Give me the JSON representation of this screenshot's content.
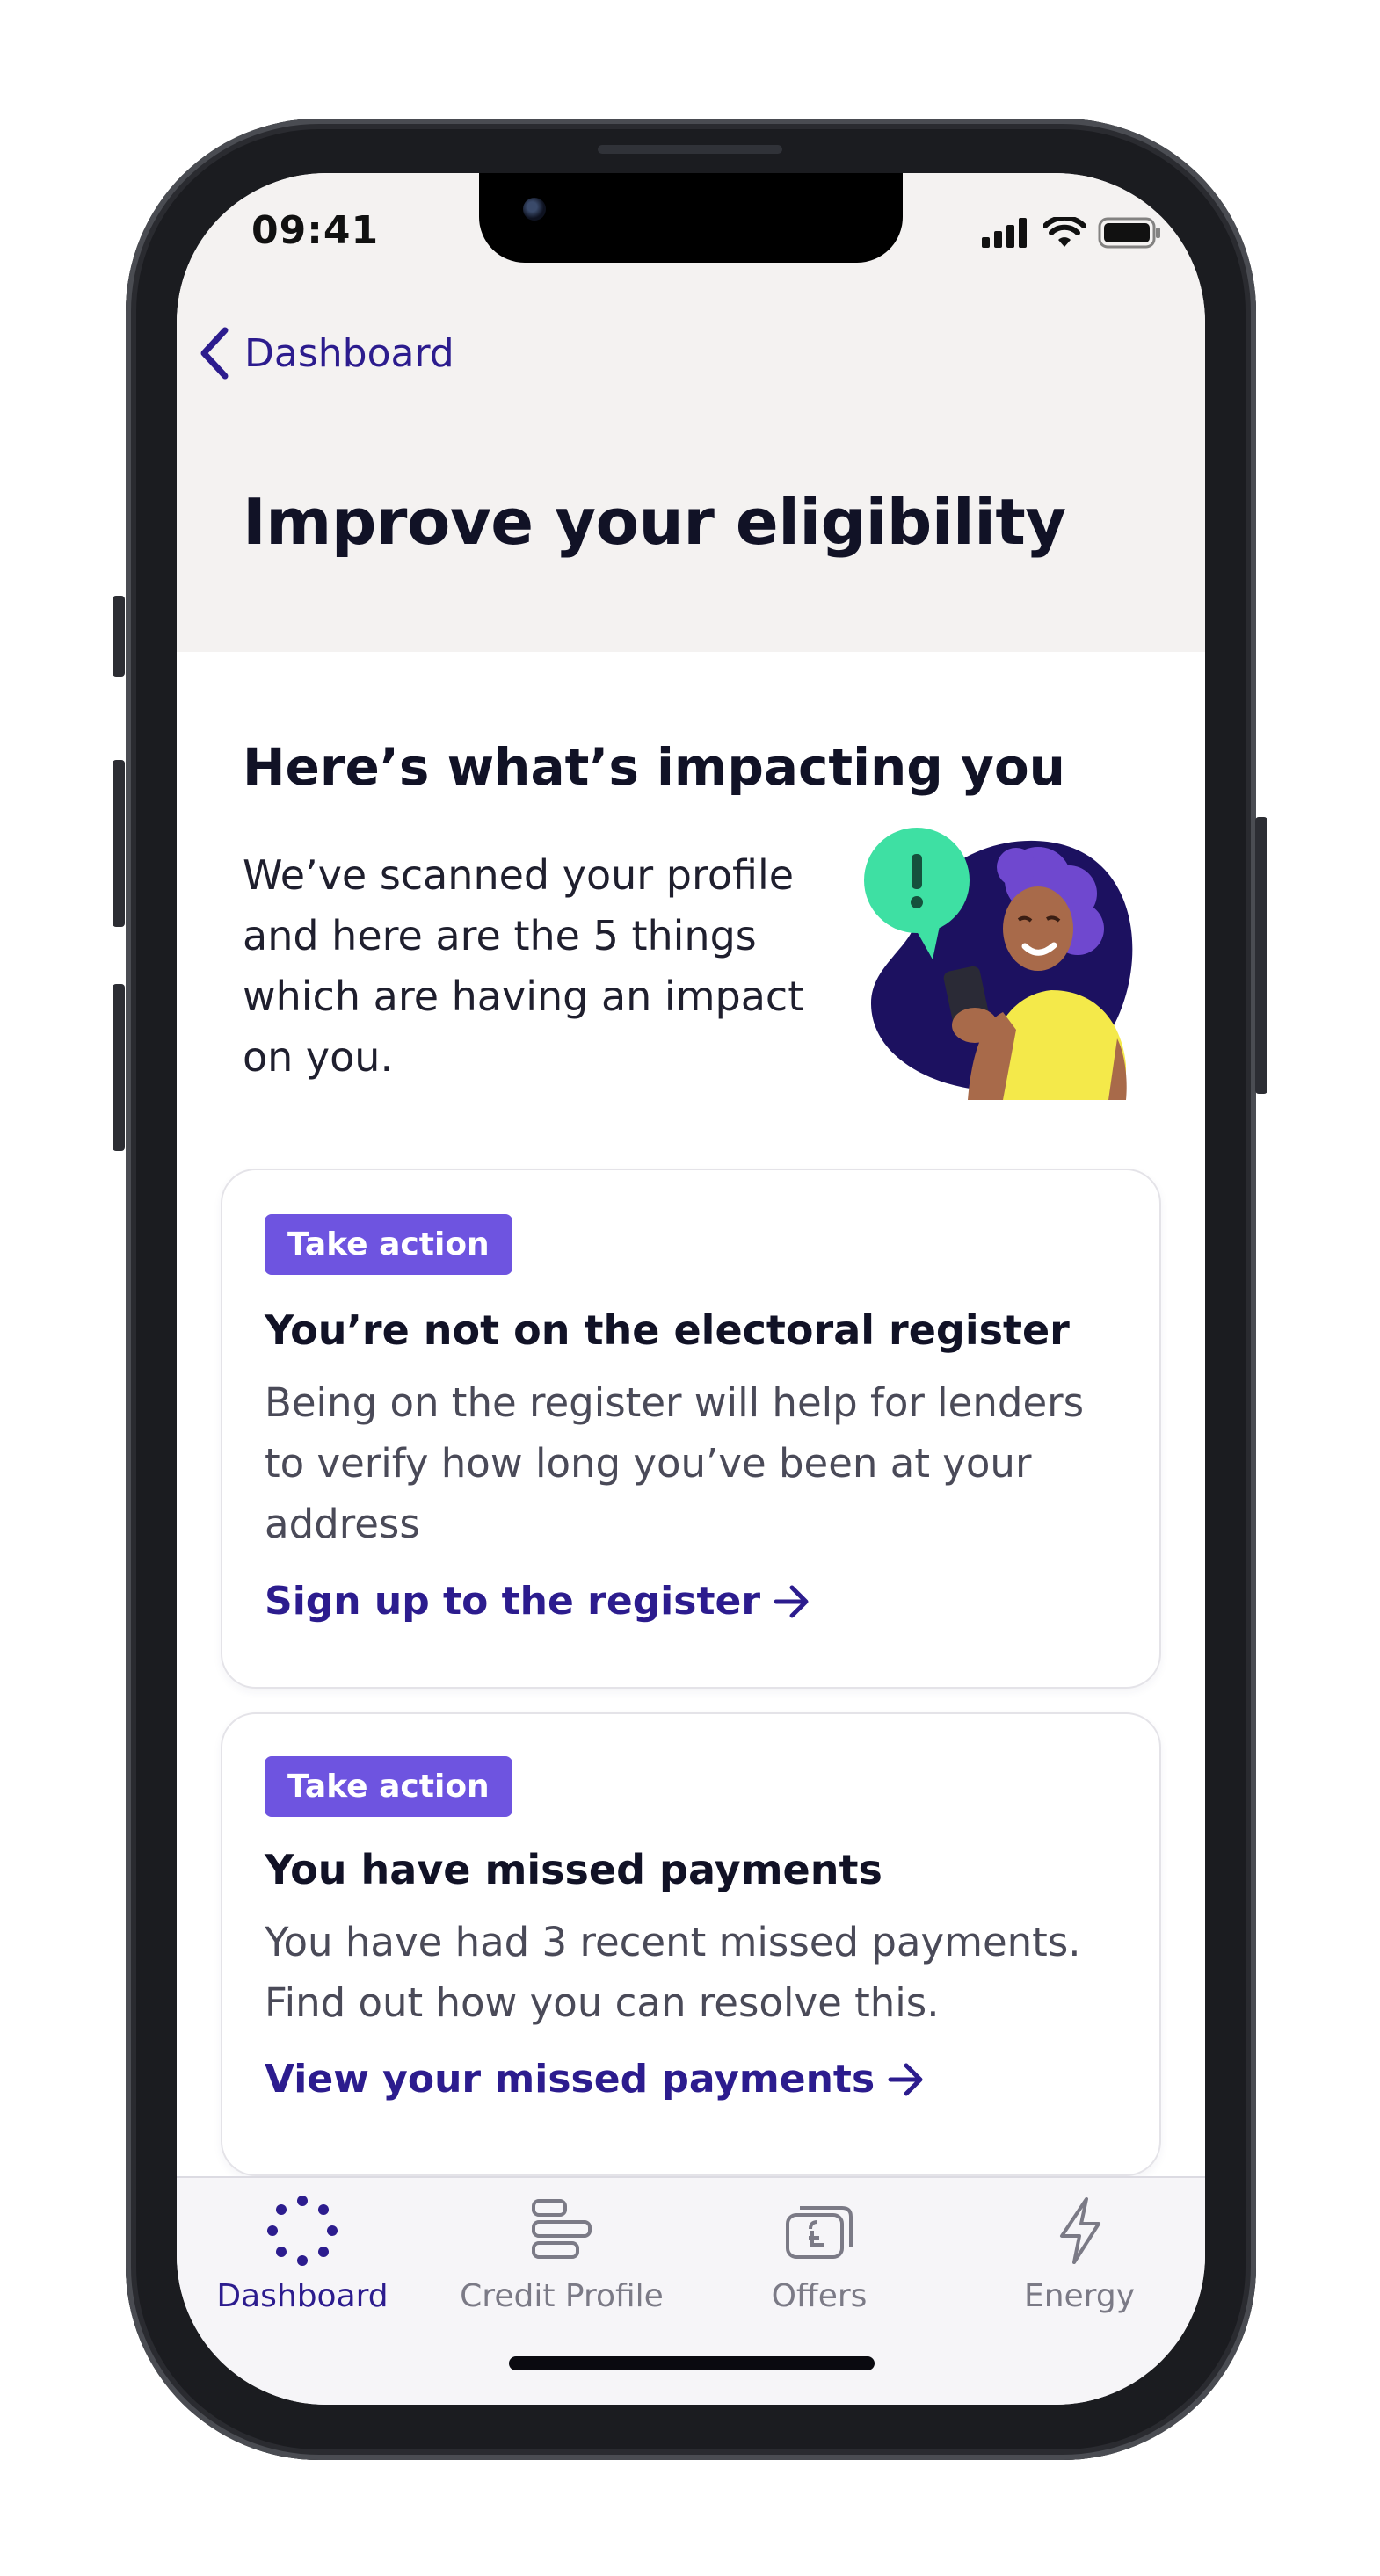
{
  "status": {
    "time": "09:41"
  },
  "nav": {
    "back_label": "Dashboard"
  },
  "page": {
    "title": "Improve your eligibility"
  },
  "intro": {
    "heading": "Here’s what’s impacting you",
    "body": "We’ve scanned your profile and here are the 5 things which are having an impact on you."
  },
  "cards": [
    {
      "badge": "Take action",
      "title": "You’re not on the electoral register",
      "body": "Being on the register will help for lenders to verify how long you’ve been at your address",
      "link": "Sign up to the register"
    },
    {
      "badge": "Take action",
      "title": "You have missed payments",
      "body": "You have had 3 recent missed payments. Find out how you can resolve this.",
      "link": "View your missed payments"
    }
  ],
  "tabbar": {
    "items": [
      {
        "label": "Dashboard",
        "icon": "dots-circle-icon",
        "active": true
      },
      {
        "label": "Credit Profile",
        "icon": "bars-icon",
        "active": false
      },
      {
        "label": "Offers",
        "icon": "wallet-pound-icon",
        "active": false
      },
      {
        "label": "Energy",
        "icon": "lightning-icon",
        "active": false
      }
    ]
  },
  "colors": {
    "accent": "#2c1c8e",
    "badge": "#6e54e0",
    "header_bg": "#f4f2f1",
    "heading_text": "#111226"
  }
}
